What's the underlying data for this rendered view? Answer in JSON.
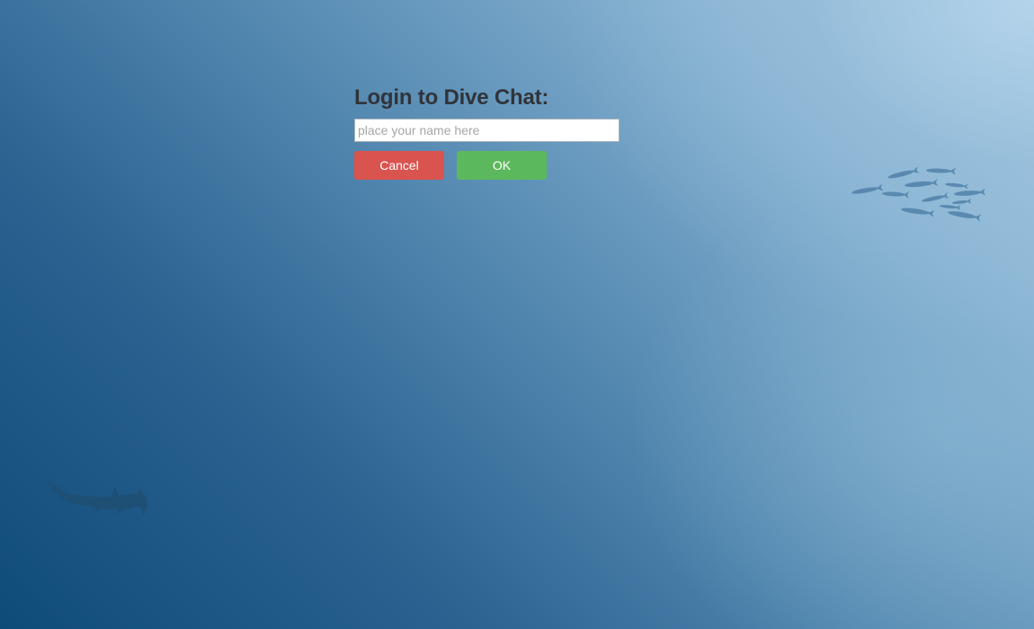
{
  "login": {
    "title": "Login to Dive Chat:",
    "name_placeholder": "place your name here",
    "name_value": "",
    "cancel_label": "Cancel",
    "ok_label": "OK"
  },
  "colors": {
    "cancel": "#d9534f",
    "ok": "#5cb85c",
    "ocean_deep": "#0f4b79",
    "ocean_light": "#aacbe3"
  },
  "decorations": {
    "school_icon": "fish-school-icon",
    "shark_icon": "hammerhead-shark-icon"
  }
}
